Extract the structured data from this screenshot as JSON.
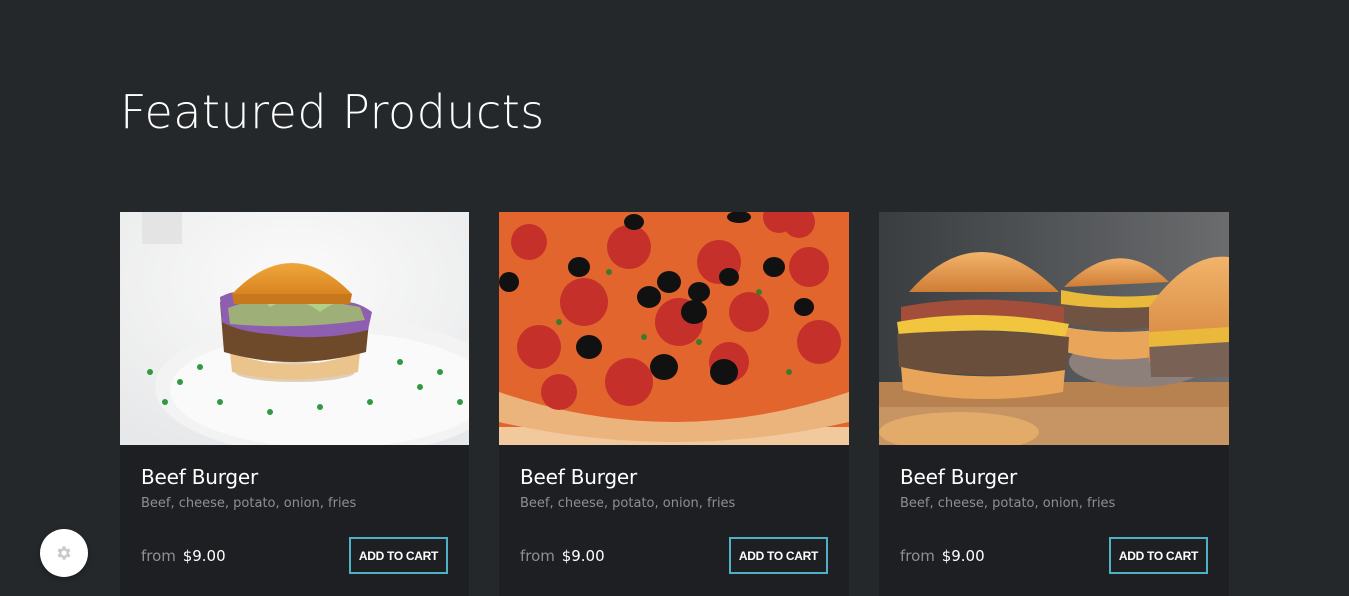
{
  "section": {
    "title": "Featured Products"
  },
  "products": [
    {
      "name": "Beef Burger",
      "description": "Beef, cheese, potato, onion, fries",
      "price_prefix": "from",
      "price": "$9.00",
      "button_label": "ADD TO CART",
      "image": "burger-on-white-plate"
    },
    {
      "name": "Beef Burger",
      "description": "Beef, cheese, potato, onion, fries",
      "price_prefix": "from",
      "price": "$9.00",
      "button_label": "ADD TO CART",
      "image": "pepperoni-olive-pizza"
    },
    {
      "name": "Beef Burger",
      "description": "Beef, cheese, potato, onion, fries",
      "price_prefix": "from",
      "price": "$9.00",
      "button_label": "ADD TO CART",
      "image": "cheeseburgers-on-board"
    }
  ],
  "settings": {
    "icon": "gear-icon"
  },
  "colors": {
    "background": "#25282b",
    "card_background": "#1d1f22",
    "accent": "#4fb0c6",
    "muted_text": "#8d8f93",
    "heading_text": "#ffffff"
  }
}
